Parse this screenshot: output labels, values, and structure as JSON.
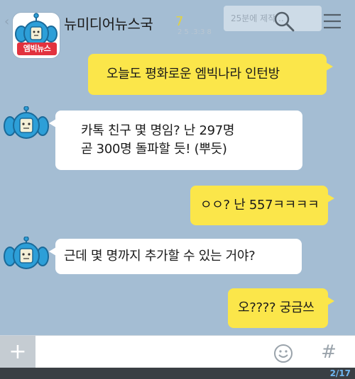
{
  "header": {
    "back_glyph": "‹",
    "room_name": "뉴미디어뉴스국",
    "member_count": "7",
    "room_badge": "엠빅뉴스",
    "notice_preview": "25분에 제작 ..",
    "notice_date": "2 5 .3:3 8 ",
    "icons": [
      "search-icon",
      "menu-icon"
    ]
  },
  "messages": [
    {
      "sender": "me",
      "lines": [
        "오늘도 평화로운 엠빅나라 인턴방"
      ]
    },
    {
      "sender": "other",
      "lines": [
        "카톡 친구 몇 명임? 난 297명",
        "곧 300명 돌파할 듯! (뿌듯)"
      ]
    },
    {
      "sender": "me",
      "lines": [
        "ㅇㅇ? 난 557ㅋㅋㅋㅋ"
      ]
    },
    {
      "sender": "other",
      "lines": [
        "근데 몇 명까지 추가할 수 있는 거야?"
      ]
    },
    {
      "sender": "me",
      "lines": [
        "오???? 궁금쓰"
      ]
    }
  ],
  "input_bar": {
    "plus_label": "+",
    "placeholder": "",
    "hash_label": "#"
  },
  "footer": {
    "page_indicator": "2/17"
  },
  "colors": {
    "background": "#a4bdd3",
    "my_bubble": "#fbe64a",
    "other_bubble": "#ffffff",
    "badge": "#e2323e",
    "robot_body": "#2d9fd8"
  }
}
